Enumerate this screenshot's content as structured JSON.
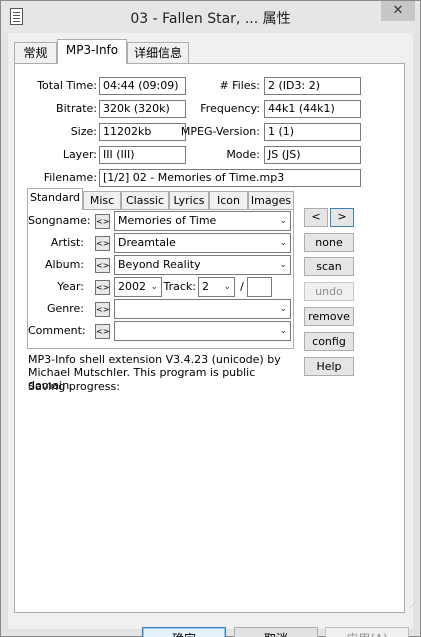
{
  "window": {
    "title": "03 - Fallen Star, ... 属性",
    "close_glyph": "✕"
  },
  "tabs": [
    {
      "label": "常规"
    },
    {
      "label": "MP3-Info"
    },
    {
      "label": "详细信息"
    }
  ],
  "info": {
    "total_time": {
      "label": "Total Time:",
      "value": "04:44 (09:09)"
    },
    "files": {
      "label": "# Files:",
      "value": "2  (ID3: 2)"
    },
    "bitrate": {
      "label": "Bitrate:",
      "value": "320k (320k)"
    },
    "frequency": {
      "label": "Frequency:",
      "value": "44k1 (44k1)"
    },
    "size": {
      "label": "Size:",
      "value": "11202kb"
    },
    "mpeg_version": {
      "label": "MPEG-Version:",
      "value": "1 (1)"
    },
    "layer": {
      "label": "Layer:",
      "value": "III (III)"
    },
    "mode": {
      "label": "Mode:",
      "value": "JS (JS)"
    },
    "filename": {
      "label": "Filename:",
      "value": "[1/2]  02 - Memories of Time.mp3"
    }
  },
  "subtabs": [
    {
      "label": "Standard"
    },
    {
      "label": "Misc"
    },
    {
      "label": "Classic"
    },
    {
      "label": "Lyrics"
    },
    {
      "label": "Icon"
    },
    {
      "label": "Images"
    }
  ],
  "fields": {
    "songname": {
      "label": "Songname:",
      "value": "Memories of Time"
    },
    "artist": {
      "label": "Artist:",
      "value": "Dreamtale"
    },
    "album": {
      "label": "Album:",
      "value": "Beyond Reality"
    },
    "year": {
      "label": "Year:",
      "value": "2002"
    },
    "track": {
      "label": "Track:",
      "value": "2",
      "separator": "/",
      "total": ""
    },
    "genre": {
      "label": "Genre:",
      "value": ""
    },
    "comment": {
      "label": "Comment:",
      "value": ""
    },
    "copy_glyph": "<>",
    "dropdown_glyph": "⌄"
  },
  "side_buttons": {
    "prev": "<",
    "next": ">",
    "none": "none",
    "scan": "scan",
    "undo": "undo",
    "remove": "remove",
    "config": "config",
    "help": "Help"
  },
  "status": {
    "line1": "MP3-Info shell extension V3.4.23 (unicode) by Michael Mutschler. This program is public domain.",
    "line2": "Saving progress:"
  },
  "bottom_buttons": {
    "ok": "确定",
    "cancel": "取消",
    "apply": "应用(A)"
  }
}
